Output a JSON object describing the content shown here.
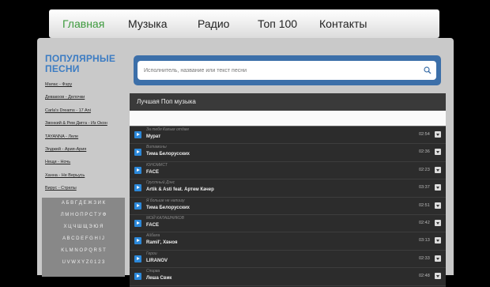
{
  "nav": [
    {
      "label": "Главная",
      "active": true
    },
    {
      "label": "Музыка",
      "active": false
    },
    {
      "label": "Радио",
      "active": false
    },
    {
      "label": "Топ 100",
      "active": false
    },
    {
      "label": "Контакты",
      "active": false
    }
  ],
  "sidebar": {
    "title": "ПОПУЛЯРНЫЕ ПЕСНИ",
    "items": [
      "Мапас - Фэру",
      "Девакоов - Делочки",
      "Carla's Dreams - 17 Ani",
      "Звонкий & Рем Дигга - Из Окон",
      "TAYANNA - Леле",
      "Элджей - Ария-Ария",
      "Нещи - Ночь",
      "Ханна - Не Верьусь",
      "Вирус - Стрелы"
    ],
    "alphabet": [
      "А Б В Г Д Е Ж З И К",
      "Л М Н О П Р С Т У Ф",
      "Х Ц Ч Ш Щ Э Ю Я",
      "A B C D E F G H I J",
      "K L M N O P Q R S T",
      "U V W X Y Z 0 1 2 3"
    ]
  },
  "search": {
    "placeholder": "Исполнитель, название или текст песни"
  },
  "list": {
    "header": "Лучшая Поп музыка",
    "tracks": [
      {
        "sub": "За тебя Калым отдам",
        "title": "Мурат",
        "dur": "02:54"
      },
      {
        "sub": "Витамины",
        "title": "Тима Белорусских",
        "dur": "02:36"
      },
      {
        "sub": "ЮНОМИСТ",
        "title": "FACE",
        "dur": "02:23"
      },
      {
        "sub": "Грустный Дэнс",
        "title": "Artik & Asti feat. Артем Качер",
        "dur": "03:37"
      },
      {
        "sub": "Я больше не напишу",
        "title": "Тима Белорусских",
        "dur": "02:51"
      },
      {
        "sub": "МОЙ КАЛАШНИКОВ",
        "title": "FACE",
        "dur": "02:42"
      },
      {
        "sub": "Айбала",
        "title": "Ramil', Хвноя",
        "dur": "03:13"
      },
      {
        "sub": "Герои",
        "title": "LIRANOV",
        "dur": "02:33"
      },
      {
        "sub": "Спирва",
        "title": "Леша Свик",
        "dur": "02:48"
      }
    ]
  },
  "icons": {
    "search": "search-icon",
    "play": "play-icon",
    "download": "download-icon"
  },
  "colors": {
    "accent": "#3c7cc3",
    "active_nav": "#3d9a3d",
    "play": "#2c88d9"
  }
}
